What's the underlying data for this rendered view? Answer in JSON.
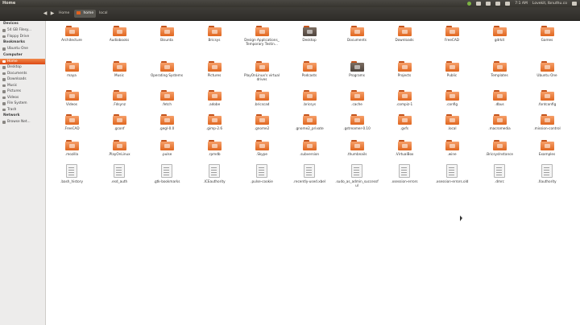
{
  "window": {
    "title": "Home"
  },
  "tray": {
    "user": "Lovekit, Ibnuthu.co",
    "time": "7:1 AM"
  },
  "breadcrumb": [
    "Home",
    "home",
    "local"
  ],
  "sidebar": {
    "sections": [
      {
        "title": "Devices",
        "items": [
          "54 GB Filesy...",
          "Floppy Drive"
        ]
      },
      {
        "title": "Bookmarks",
        "items": [
          "Ubuntu One"
        ]
      },
      {
        "title": "Computer",
        "items": [
          "Home",
          "Desktop",
          "Documents",
          "Downloads",
          "Music",
          "Pictures",
          "Videos",
          "File System",
          "Trash"
        ]
      },
      {
        "title": "Network",
        "items": [
          "Browse Net..."
        ]
      }
    ],
    "selected": "Home"
  },
  "rows": [
    [
      {
        "name": "Architecture",
        "kind": "folder"
      },
      {
        "name": "Audiobooks",
        "kind": "folder"
      },
      {
        "name": "Bisunta",
        "kind": "folder"
      },
      {
        "name": "Bricsys",
        "kind": "folder"
      },
      {
        "name": "Design Applications_ Temporary Testin...",
        "kind": "folder"
      },
      {
        "name": "Desktop",
        "kind": "folder-dark"
      },
      {
        "name": "Documents",
        "kind": "folder"
      },
      {
        "name": "Downloads",
        "kind": "folder"
      },
      {
        "name": "FreeCAD",
        "kind": "folder"
      },
      {
        "name": "gdrkit",
        "kind": "folder"
      },
      {
        "name": "Games",
        "kind": "folder"
      }
    ],
    [
      {
        "name": "maya",
        "kind": "folder"
      },
      {
        "name": "Music",
        "kind": "folder"
      },
      {
        "name": "Operating Systems",
        "kind": "folder"
      },
      {
        "name": "Pictures",
        "kind": "folder"
      },
      {
        "name": "PlayOnLinux's virtual drives",
        "kind": "folder"
      },
      {
        "name": "Podcasts",
        "kind": "folder"
      },
      {
        "name": "Programs",
        "kind": "folder-dark"
      },
      {
        "name": "Projects",
        "kind": "folder"
      },
      {
        "name": "Public",
        "kind": "folder"
      },
      {
        "name": "Templates",
        "kind": "folder"
      },
      {
        "name": "Ubuntu One",
        "kind": "folder"
      }
    ],
    [
      {
        "name": "Videos",
        "kind": "folder"
      },
      {
        "name": ".Fdsynz",
        "kind": "folder"
      },
      {
        "name": ".fetch",
        "kind": "folder"
      },
      {
        "name": ".adobe",
        "kind": "folder"
      },
      {
        "name": ".bricscad",
        "kind": "folder"
      },
      {
        "name": ".bricsys",
        "kind": "folder"
      },
      {
        "name": ".cache",
        "kind": "folder"
      },
      {
        "name": ".compiz-1",
        "kind": "folder"
      },
      {
        "name": ".config",
        "kind": "folder"
      },
      {
        "name": ".dbus",
        "kind": "folder"
      },
      {
        "name": ".fontconfig",
        "kind": "folder"
      }
    ],
    [
      {
        "name": ".FreeCAD",
        "kind": "folder"
      },
      {
        "name": ".gconf",
        "kind": "folder"
      },
      {
        "name": ".gegl-0.0",
        "kind": "folder"
      },
      {
        "name": ".gimp-2.6",
        "kind": "folder"
      },
      {
        "name": ".gnome2",
        "kind": "folder"
      },
      {
        "name": ".gnome2_private",
        "kind": "folder"
      },
      {
        "name": ".gstreamer-0.10",
        "kind": "folder"
      },
      {
        "name": ".gvfs",
        "kind": "folder"
      },
      {
        "name": ".local",
        "kind": "folder"
      },
      {
        "name": ".macromedia",
        "kind": "folder"
      },
      {
        "name": ".mission-control",
        "kind": "folder"
      }
    ],
    [
      {
        "name": ".mozilla",
        "kind": "folder"
      },
      {
        "name": ".PlayOnLinux",
        "kind": "folder"
      },
      {
        "name": ".pulse",
        "kind": "folder"
      },
      {
        "name": ".rpmdb",
        "kind": "folder"
      },
      {
        "name": ".Skype",
        "kind": "folder"
      },
      {
        "name": ".subversion",
        "kind": "folder"
      },
      {
        "name": ".thumbnails",
        "kind": "folder"
      },
      {
        "name": ".VirtualBox",
        "kind": "folder"
      },
      {
        "name": ".wine",
        "kind": "folder"
      },
      {
        "name": ".BricsysInstance",
        "kind": "folder"
      },
      {
        "name": "Examples",
        "kind": "folder"
      }
    ],
    [
      {
        "name": ".bash_history",
        "kind": "doc"
      },
      {
        "name": ".esd_auth",
        "kind": "doc"
      },
      {
        "name": ".gtk-bookmarks",
        "kind": "doc"
      },
      {
        "name": ".ICEauthority",
        "kind": "doc"
      },
      {
        "name": ".pulse-cookie",
        "kind": "doc"
      },
      {
        "name": ".recently-used.xbel",
        "kind": "doc"
      },
      {
        "name": ".sudo_as_admin_successful",
        "kind": "doc"
      },
      {
        "name": ".xsession-errors",
        "kind": "doc"
      },
      {
        "name": ".xsession-errors.old",
        "kind": "doc"
      },
      {
        "name": ".dmrc",
        "kind": "doc"
      },
      {
        "name": ".Xauthority",
        "kind": "doc"
      }
    ]
  ]
}
